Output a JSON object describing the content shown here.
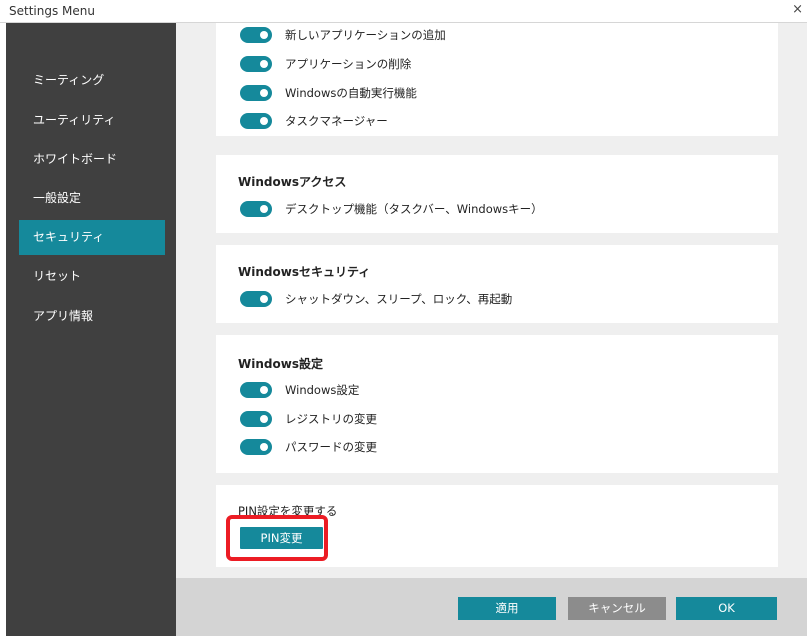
{
  "window": {
    "title": "Settings Menu",
    "close_glyph": "×"
  },
  "sidebar": {
    "items": [
      {
        "label": "ミーティング"
      },
      {
        "label": "ユーティリティ"
      },
      {
        "label": "ホワイトボード"
      },
      {
        "label": "一般設定"
      },
      {
        "label": "セキュリティ",
        "active": true
      },
      {
        "label": "リセット"
      },
      {
        "label": "アプリ情報"
      }
    ]
  },
  "sections": {
    "apps": {
      "toggles": [
        {
          "label": "新しいアプリケーションの追加",
          "on": true
        },
        {
          "label": "アプリケーションの削除",
          "on": true
        },
        {
          "label": "Windowsの自動実行機能",
          "on": true
        },
        {
          "label": "タスクマネージャー",
          "on": true
        }
      ]
    },
    "access": {
      "title": "Windowsアクセス",
      "toggles": [
        {
          "label": "デスクトップ機能（タスクバー、Windowsキー）",
          "on": true
        }
      ]
    },
    "security": {
      "title": "Windowsセキュリティ",
      "toggles": [
        {
          "label": "シャットダウン、スリープ、ロック、再起動",
          "on": true
        }
      ]
    },
    "settings": {
      "title": "Windows設定",
      "toggles": [
        {
          "label": "Windows設定",
          "on": true
        },
        {
          "label": "レジストリの変更",
          "on": true
        },
        {
          "label": "パスワードの変更",
          "on": true
        }
      ]
    },
    "pin": {
      "label": "PIN設定を変更する",
      "button": "PIN変更"
    }
  },
  "footer": {
    "apply": "適用",
    "cancel": "キャンセル",
    "ok": "OK"
  },
  "colors": {
    "accent": "#15899b",
    "sidebar": "#404040",
    "highlight": "#ec1c24",
    "cancel": "#8c8c8c"
  }
}
